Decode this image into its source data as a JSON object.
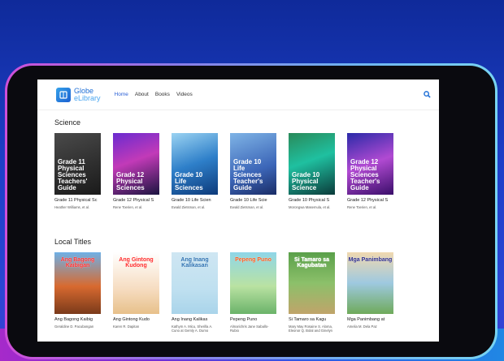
{
  "app": {
    "logo_line1": "Globe",
    "logo_line2": "eLibrary"
  },
  "nav": {
    "items": [
      "Home",
      "About",
      "Books",
      "Videos"
    ],
    "active": "Home"
  },
  "icons": {
    "search": "search-icon",
    "logo": "book-logo-icon"
  },
  "sections": {
    "science": {
      "title": "Science",
      "books": [
        {
          "cover": "Grade 11 Physical Sciences Teachers' Guide",
          "title": "Grade 11 Physical Sc",
          "author": "Heather Williams, et al."
        },
        {
          "cover": "Grade 12 Physical Sciences",
          "title": "Grade 12 Physical S",
          "author": "Rene Toerien, et al."
        },
        {
          "cover": "Grade 10 Life Sciences",
          "title": "Grade 10 Life Scien",
          "author": "Ewald Zietsman, et al."
        },
        {
          "cover": "Grade 10 Life Sciences Teacher's Guide",
          "title": "Grade 10 Life Scie",
          "author": "Ewald Zietsman, et al."
        },
        {
          "cover": "Grade 10 Physical Science",
          "title": "Grade 10 Physical S",
          "author": "Morongwa Masemula, et al."
        },
        {
          "cover": "Grade 12 Physical Sciences Teacher's Guide",
          "title": "Grade 12 Physical S",
          "author": "Rene Toerien, et al."
        }
      ]
    },
    "local": {
      "title": "Local Titles",
      "books": [
        {
          "cover": "Ang Bagong Kaibigan",
          "title": "Ang Bagong Kaibig",
          "author": "Geraldine D. Pacubangan"
        },
        {
          "cover": "Ang Gintong Kudong",
          "title": "Ang Gintong Kudo",
          "author": "Karen R. Dapitan"
        },
        {
          "cover": "Ang Inang Kalikasan",
          "title": "Ang Inang Kalikas",
          "author": "Kathym A. Micu, Sherilla A. Cuno at Gemly A. Dumo"
        },
        {
          "cover": "Pepeng Puno",
          "title": "Pepeng Puno",
          "author": "Almarichris Jane Saballo-Rubio"
        },
        {
          "cover": "Si Tamaro sa Kagubatan",
          "title": "Si Tamaro sa Kagu",
          "author": "Mary May Rosaine S. Aloma, Eleonor Q. Bolal and Ginelyn S. Deniega"
        },
        {
          "cover": "Mga Panimbang",
          "title": "Mga Panimbang at",
          "author": "Amelia M. Dela Paz"
        }
      ]
    }
  }
}
